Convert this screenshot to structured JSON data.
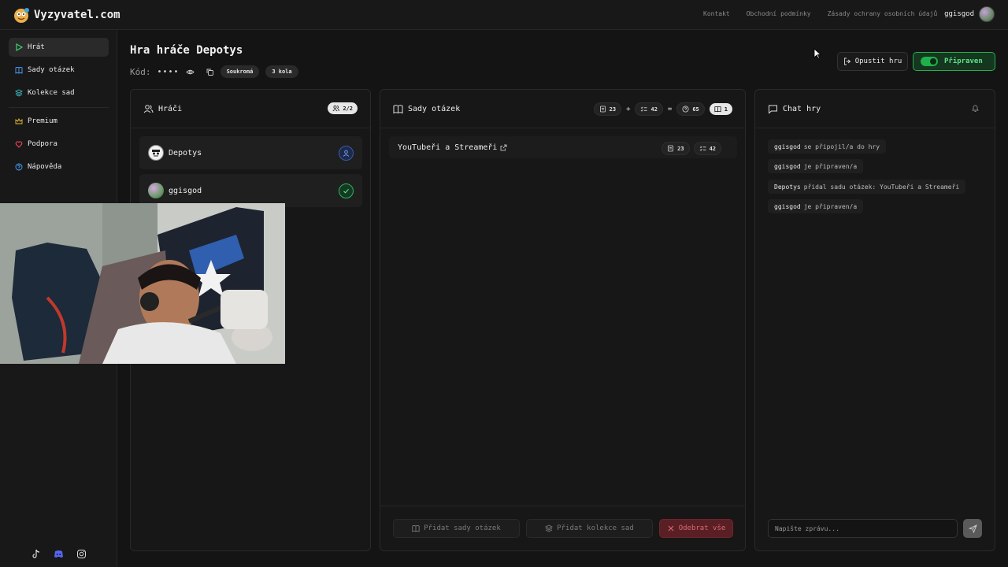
{
  "brand": {
    "name": "Vyzyvatel.com"
  },
  "toplinks": [
    "Kontakt",
    "Obchodní podmínky",
    "Zásady ochrany osobních údajů"
  ],
  "user": {
    "name": "ggisgod"
  },
  "sidebar": {
    "items": [
      {
        "label": "Hrát",
        "icon": "play-icon",
        "active": true
      },
      {
        "label": "Sady otázek",
        "icon": "book-icon"
      },
      {
        "label": "Kolekce sad",
        "icon": "layers-icon"
      },
      {
        "label": "Premium",
        "icon": "crown-icon"
      },
      {
        "label": "Podpora",
        "icon": "heart-icon"
      },
      {
        "label": "Nápověda",
        "icon": "help-icon"
      }
    ],
    "socials": [
      "tiktok-icon",
      "discord-icon",
      "instagram-icon"
    ]
  },
  "game": {
    "title": "Hra hráče Depotys",
    "code_label": "Kód:",
    "code_masked": "••••",
    "privacy": "Soukromá",
    "rounds": "3 kola",
    "leave_label": "Opustit hru",
    "ready_label": "Připraven"
  },
  "players_panel": {
    "title": "Hráči",
    "count": "2/2",
    "players": [
      {
        "name": "Depotys",
        "role": "host"
      },
      {
        "name": "ggisgod",
        "role": "ready"
      }
    ]
  },
  "sets_panel": {
    "title": "Sady otázek",
    "summary": {
      "a": "23",
      "plus": "+",
      "b": "42",
      "eq": "=",
      "total": "65",
      "sets": "1"
    },
    "sets": [
      {
        "name": "YouTubeři a Streameři",
        "count_a": "23",
        "count_b": "42"
      }
    ],
    "add_sets_label": "Přidat sady otázek",
    "add_collections_label": "Přidat kolekce sad",
    "remove_all_label": "Odebrat vše"
  },
  "chat": {
    "title": "Chat hry",
    "messages": [
      {
        "user": "ggisgod",
        "text": "se připojil/a do hry"
      },
      {
        "user": "ggisgod",
        "text": "je připraven/a"
      },
      {
        "user": "Depotys",
        "text": "přidal sadu otázek: YouTubeři a Streameři"
      },
      {
        "user": "ggisgod",
        "text": "je připraven/a"
      }
    ],
    "placeholder": "Napište zprávu..."
  },
  "colors": {
    "accent_green": "#23b14d",
    "danger": "#d66a72",
    "bg": "#141414"
  }
}
